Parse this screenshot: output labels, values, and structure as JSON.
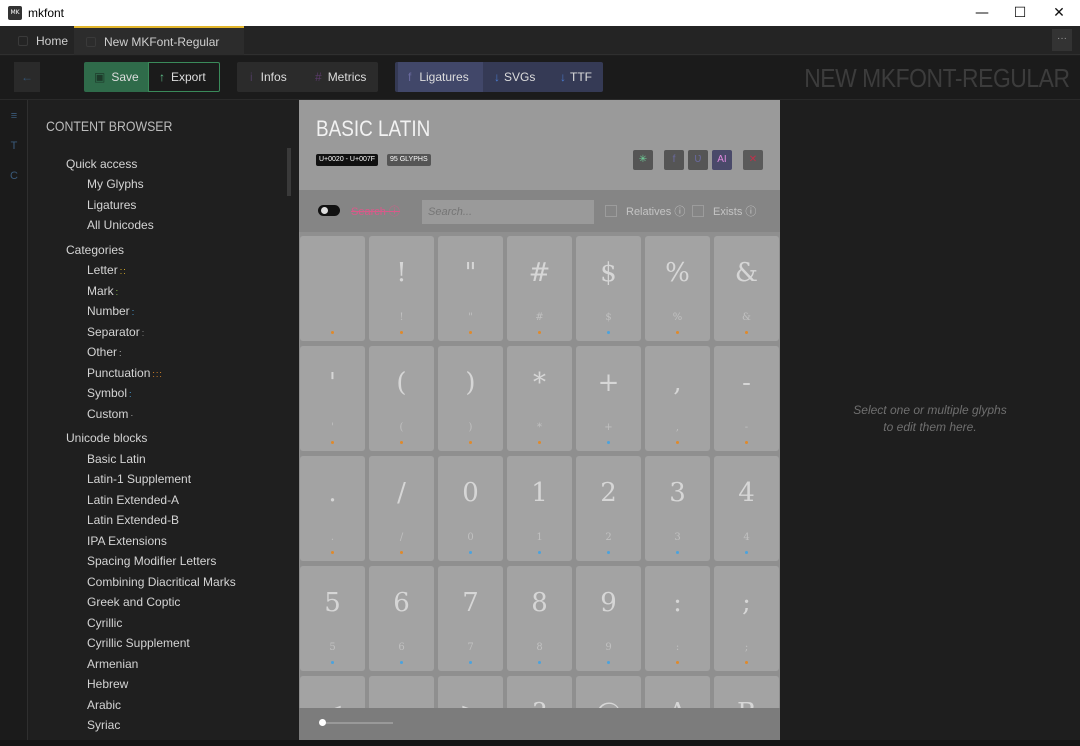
{
  "window": {
    "app_title": "mkfont",
    "logo_text": "MK",
    "minimize": "—",
    "maximize": "☐",
    "close": "✕"
  },
  "tabs": [
    {
      "label": "Home"
    },
    {
      "label": "New MKFont-Regular"
    }
  ],
  "more_label": "···",
  "toolbar": {
    "back": "←",
    "save": "Save",
    "export": "Export",
    "infos": "Infos",
    "metrics": "Metrics",
    "ligatures": "Ligatures",
    "svgs": "SVGs",
    "ttf": "TTF",
    "document_title": "NEW MKFONT-REGULAR"
  },
  "rail": [
    "≡",
    "T",
    "C"
  ],
  "browser": {
    "heading": "CONTENT BROWSER",
    "quick_access": {
      "label": "Quick access",
      "items": [
        "My Glyphs",
        "Ligatures",
        "All Unicodes"
      ]
    },
    "categories": {
      "label": "Categories",
      "items": [
        {
          "label": "Letter",
          "dots": "::",
          "color": "#e2b52b"
        },
        {
          "label": "Mark",
          "dots": ":",
          "color": "#8bc34a"
        },
        {
          "label": "Number",
          "dots": ":",
          "color": "#4aa3df"
        },
        {
          "label": "Separator",
          "dots": ":",
          "color": "#888888"
        },
        {
          "label": "Other",
          "dots": ":",
          "color": "#bbbbbb"
        },
        {
          "label": "Punctuation",
          "dots": ":::",
          "color": "#e08a2b"
        },
        {
          "label": "Symbol",
          "dots": ":",
          "color": "#4aa3df"
        },
        {
          "label": "Custom",
          "dots": "·",
          "color": "#aaaaaa"
        }
      ]
    },
    "unicode_blocks": {
      "label": "Unicode blocks",
      "items": [
        "Basic Latin",
        "Latin-1 Supplement",
        "Latin Extended-A",
        "Latin Extended-B",
        "IPA Extensions",
        "Spacing Modifier Letters",
        "Combining Diacritical Marks",
        "Greek and Coptic",
        "Cyrillic",
        "Cyrillic Supplement",
        "Armenian",
        "Hebrew",
        "Arabic",
        "Syriac"
      ]
    }
  },
  "block": {
    "title": "BASIC LATIN",
    "range": "U+0020 - U+007F",
    "count": "95 GLYPHS",
    "actions": [
      "✳",
      "f",
      "Ʋ",
      "AI",
      "✕"
    ]
  },
  "search": {
    "label": "Search",
    "placeholder": "Search...",
    "relatives": "Relatives",
    "exists": "Exists",
    "info": "ⓘ"
  },
  "glyphs": [
    {
      "g": " ",
      "s": " ",
      "c": "#e08a2b"
    },
    {
      "g": "!",
      "s": "!",
      "c": "#e08a2b"
    },
    {
      "g": "\"",
      "s": "\"",
      "c": "#e08a2b"
    },
    {
      "g": "#",
      "s": "#",
      "c": "#e08a2b"
    },
    {
      "g": "$",
      "s": "$",
      "c": "#4aa3df"
    },
    {
      "g": "%",
      "s": "%",
      "c": "#e08a2b"
    },
    {
      "g": "&",
      "s": "&",
      "c": "#e08a2b"
    },
    {
      "g": "'",
      "s": "'",
      "c": "#e08a2b"
    },
    {
      "g": "(",
      "s": "(",
      "c": "#e08a2b"
    },
    {
      "g": ")",
      "s": ")",
      "c": "#e08a2b"
    },
    {
      "g": "*",
      "s": "*",
      "c": "#e08a2b"
    },
    {
      "g": "+",
      "s": "+",
      "c": "#4aa3df"
    },
    {
      "g": ",",
      "s": ",",
      "c": "#e08a2b"
    },
    {
      "g": "-",
      "s": "-",
      "c": "#e08a2b"
    },
    {
      "g": ".",
      "s": ".",
      "c": "#e08a2b"
    },
    {
      "g": "/",
      "s": "/",
      "c": "#e08a2b"
    },
    {
      "g": "0",
      "s": "0",
      "c": "#4aa3df"
    },
    {
      "g": "1",
      "s": "1",
      "c": "#4aa3df"
    },
    {
      "g": "2",
      "s": "2",
      "c": "#4aa3df"
    },
    {
      "g": "3",
      "s": "3",
      "c": "#4aa3df"
    },
    {
      "g": "4",
      "s": "4",
      "c": "#4aa3df"
    },
    {
      "g": "5",
      "s": "5",
      "c": "#4aa3df"
    },
    {
      "g": "6",
      "s": "6",
      "c": "#4aa3df"
    },
    {
      "g": "7",
      "s": "7",
      "c": "#4aa3df"
    },
    {
      "g": "8",
      "s": "8",
      "c": "#4aa3df"
    },
    {
      "g": "9",
      "s": "9",
      "c": "#4aa3df"
    },
    {
      "g": ":",
      "s": ":",
      "c": "#e08a2b"
    },
    {
      "g": ";",
      "s": ";",
      "c": "#e08a2b"
    },
    {
      "g": "<",
      "s": "<",
      "c": "#4aa3df"
    },
    {
      "g": "=",
      "s": "=",
      "c": "#4aa3df"
    },
    {
      "g": ">",
      "s": ">",
      "c": "#4aa3df"
    },
    {
      "g": "?",
      "s": "?",
      "c": "#e08a2b"
    },
    {
      "g": "@",
      "s": "@",
      "c": "#e08a2b"
    },
    {
      "g": "A",
      "s": "A",
      "c": "#e2b52b"
    },
    {
      "g": "B",
      "s": "B",
      "c": "#e2b52b"
    }
  ],
  "editor_hint": [
    "Select one or multiple glyphs",
    "to edit them here."
  ],
  "colors": {
    "accent_tab": "#e2b52b",
    "save_bg": "#2f6b4a",
    "export_border": "#3a8a5a",
    "ligature_group_bg": "#353a55",
    "close_red": "#c0304a"
  }
}
